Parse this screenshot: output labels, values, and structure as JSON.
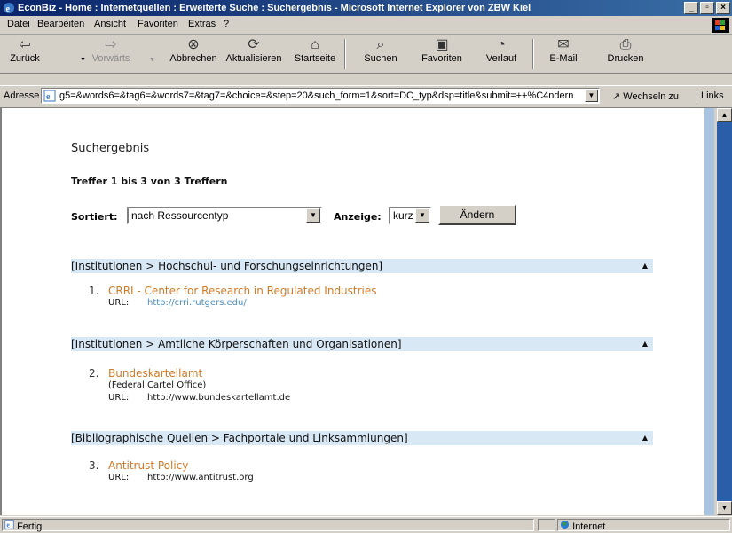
{
  "window": {
    "title": "EconBiz - Home : Internetquellen : Erweiterte Suche : Suchergebnis - Microsoft Internet Explorer von ZBW Kiel"
  },
  "menu": [
    "Datei",
    "Bearbeiten",
    "Ansicht",
    "Favoriten",
    "Extras",
    "?"
  ],
  "toolbar": {
    "back": "Zurück",
    "forward": "Vorwärts",
    "stop": "Abbrechen",
    "refresh": "Aktualisieren",
    "home": "Startseite",
    "search": "Suchen",
    "favorites": "Favoriten",
    "history": "Verlauf",
    "mail": "E-Mail",
    "print": "Drucken"
  },
  "address": {
    "label": "Adresse",
    "url": "g5=&words6=&tag6=&words7=&tag7=&choice=&step=20&such_form=1&sort=DC_typ&dsp=title&submit=++%C4ndern++",
    "go": "Wechseln zu",
    "links": "Links"
  },
  "page": {
    "heading": "Suchergebnis",
    "hits": "Treffer 1 bis 3 von 3 Treffern",
    "sort_label": "Sortiert:",
    "sort_value": "nach Ressourcentyp",
    "display_label": "Anzeige:",
    "display_value": "kurz",
    "submit": "Ändern",
    "url_label": "URL:",
    "categories": [
      {
        "label": "[Institutionen > Hochschul- und Forschungseinrichtungen]",
        "entries": [
          {
            "num": "1.",
            "title": "CRRI - Center for Research in Regulated Industries",
            "url": "http://crri.rutgers.edu/"
          }
        ]
      },
      {
        "label": "[Institutionen > Amtliche Körperschaften und Organisationen]",
        "entries": [
          {
            "num": "2.",
            "title": "Bundeskartellamt",
            "subtitle": "(Federal Cartel Office)",
            "url": "http://www.bundeskartellamt.de"
          }
        ]
      },
      {
        "label": "[Bibliographische Quellen > Fachportale und Linksammlungen]",
        "entries": [
          {
            "num": "3.",
            "title": "Antitrust Policy",
            "url": "http://www.antitrust.org"
          }
        ]
      }
    ]
  },
  "status": {
    "left": "Fertig",
    "zone": "Internet"
  }
}
